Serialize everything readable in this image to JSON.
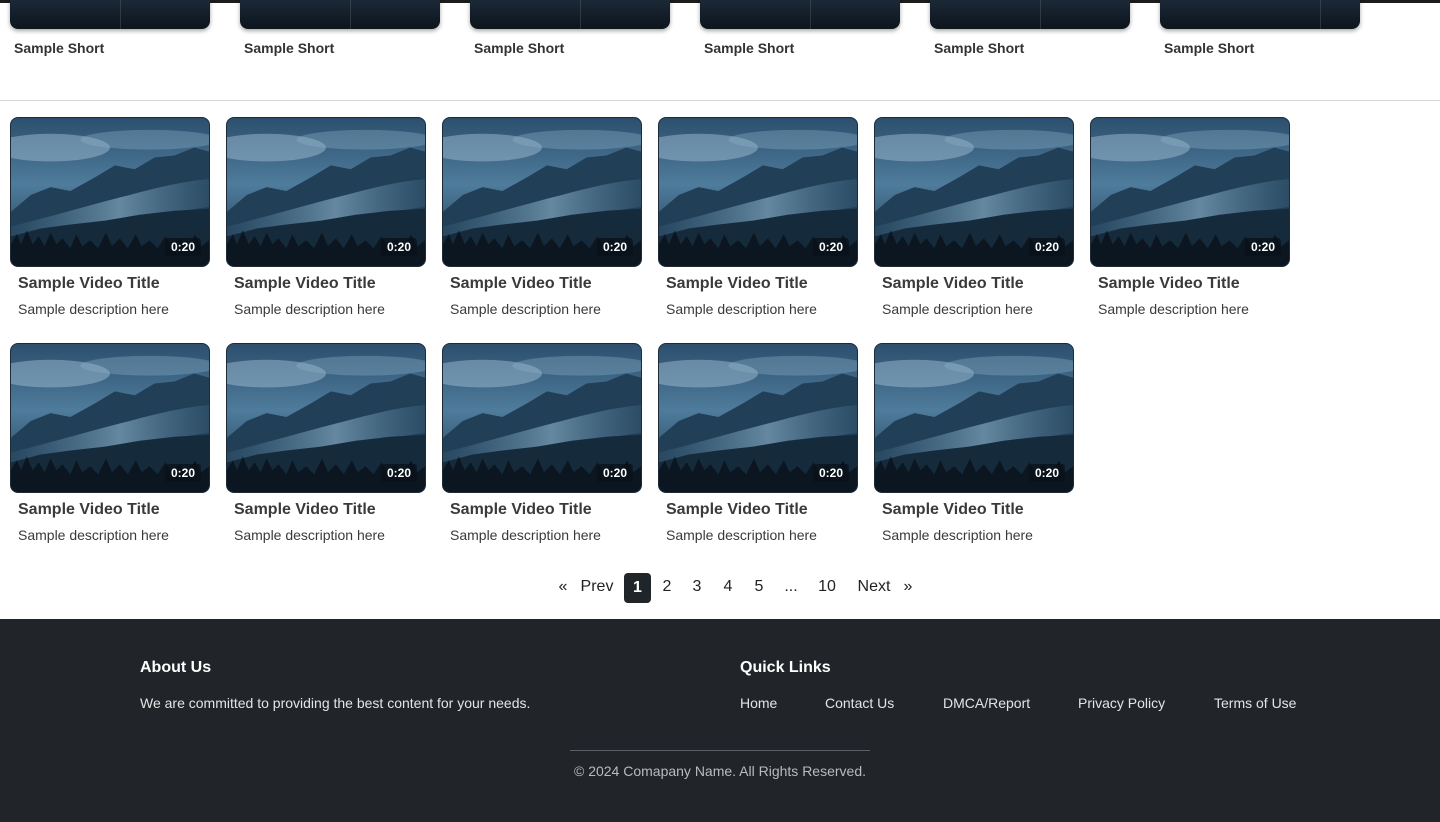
{
  "shorts": [
    {
      "title": "Sample Short"
    },
    {
      "title": "Sample Short"
    },
    {
      "title": "Sample Short"
    },
    {
      "title": "Sample Short"
    },
    {
      "title": "Sample Short"
    },
    {
      "title": "Sample Short"
    }
  ],
  "videos": [
    {
      "title": "Sample Video Title",
      "description": "Sample description here",
      "duration": "0:20"
    },
    {
      "title": "Sample Video Title",
      "description": "Sample description here",
      "duration": "0:20"
    },
    {
      "title": "Sample Video Title",
      "description": "Sample description here",
      "duration": "0:20"
    },
    {
      "title": "Sample Video Title",
      "description": "Sample description here",
      "duration": "0:20"
    },
    {
      "title": "Sample Video Title",
      "description": "Sample description here",
      "duration": "0:20"
    },
    {
      "title": "Sample Video Title",
      "description": "Sample description here",
      "duration": "0:20"
    },
    {
      "title": "Sample Video Title",
      "description": "Sample description here",
      "duration": "0:20"
    },
    {
      "title": "Sample Video Title",
      "description": "Sample description here",
      "duration": "0:20"
    },
    {
      "title": "Sample Video Title",
      "description": "Sample description here",
      "duration": "0:20"
    },
    {
      "title": "Sample Video Title",
      "description": "Sample description here",
      "duration": "0:20"
    },
    {
      "title": "Sample Video Title",
      "description": "Sample description here",
      "duration": "0:20"
    }
  ],
  "pagination": {
    "prev_arrow": "«",
    "prev_label": "Prev",
    "pages": [
      "1",
      "2",
      "3",
      "4",
      "5"
    ],
    "ellipsis": "...",
    "last_page": "10",
    "next_label": "Next",
    "next_arrow": "»",
    "current_page": "1"
  },
  "footer": {
    "about_heading": "About Us",
    "about_text": "We are committed to providing the best content for your needs.",
    "links_heading": "Quick Links",
    "links": [
      "Home",
      "Contact Us",
      "DMCA/Report",
      "Privacy Policy",
      "Terms of Use"
    ],
    "copyright": "© 2024 Comapany Name. All Rights Reserved."
  },
  "colors": {
    "footer_bg": "#212529",
    "active_page_bg": "#1f2529",
    "thumbnail_tint": "#163049"
  }
}
